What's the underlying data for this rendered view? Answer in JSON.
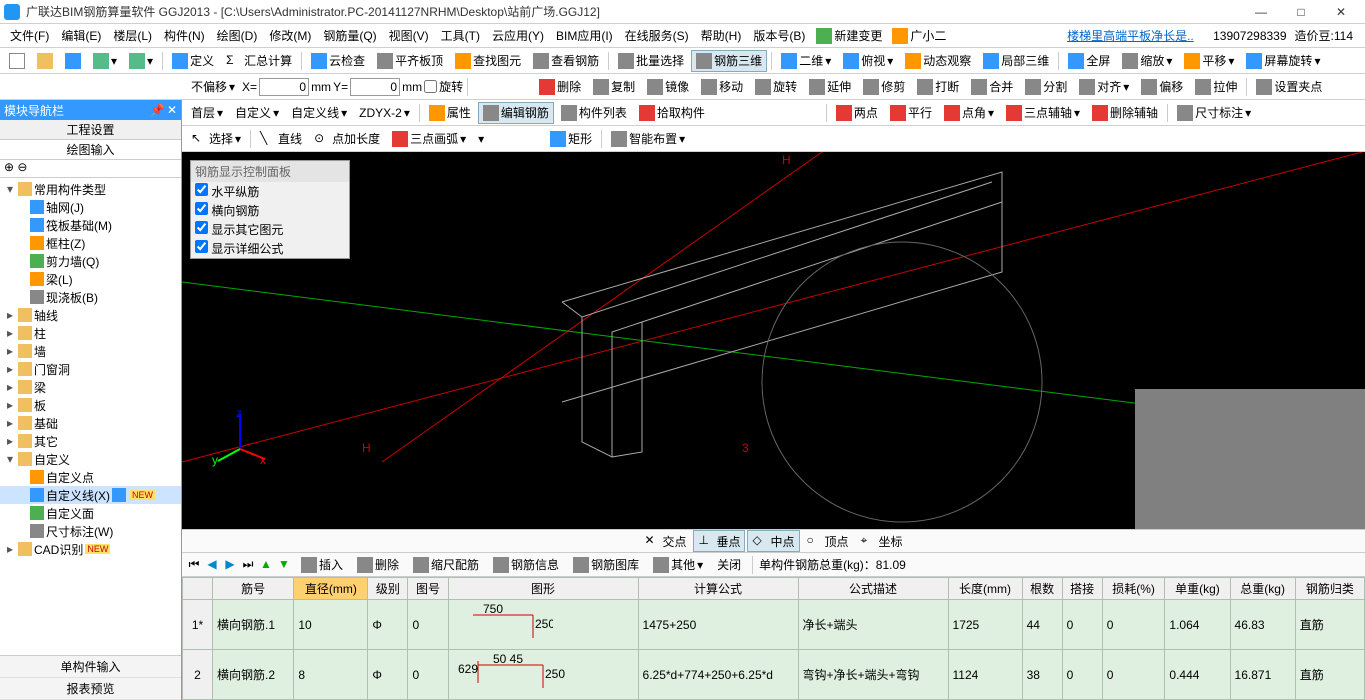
{
  "title": "广联达BIM钢筋算量软件 GGJ2013 - [C:\\Users\\Administrator.PC-20141127NRHM\\Desktop\\站前广场.GGJ12]",
  "menu": [
    "文件(F)",
    "编辑(E)",
    "楼层(L)",
    "构件(N)",
    "绘图(D)",
    "修改(M)",
    "钢筋量(Q)",
    "视图(V)",
    "工具(T)",
    "云应用(Y)",
    "BIM应用(I)",
    "在线服务(S)",
    "帮助(H)",
    "版本号(B)"
  ],
  "menuRight": {
    "newchange": "新建变更",
    "user": "广小二",
    "link": "楼梯里高端平板净长是..",
    "account": "13907298339",
    "credits": "造价豆:114"
  },
  "tb1": {
    "define": "定义",
    "sumcalc": "汇总计算",
    "cloudcheck": "云检查",
    "leveltop": "平齐板顶",
    "findgraph": "查找图元",
    "viewrebar": "查看钢筋",
    "batchsel": "批量选择",
    "rebar3d": "钢筋三维",
    "view2d": "二维",
    "bird": "俯视",
    "dynview": "动态观察",
    "localview": "局部三维",
    "fullscreen": "全屏",
    "zoom": "缩放",
    "pan": "平移",
    "rotscreen": "屏幕旋转"
  },
  "tb2": {
    "nooffset": "不偏移",
    "x": "X=",
    "xv": "0",
    "mm": "mm",
    "y": "Y=",
    "yv": "0",
    "rotate": "旋转",
    "del": "删除",
    "copy": "复制",
    "mirror": "镜像",
    "move": "移动",
    "rot": "旋转",
    "extend": "延伸",
    "trim": "修剪",
    "break": "打断",
    "merge": "合并",
    "split": "分割",
    "align": "对齐",
    "offset": "偏移",
    "stretch": "拉伸",
    "setclip": "设置夹点"
  },
  "tb3": {
    "floor": "首层",
    "custom": "自定义",
    "customline": "自定义线",
    "zdyx": "ZDYX-2",
    "attr": "属性",
    "editrebar": "编辑钢筋",
    "complist": "构件列表",
    "pickcomp": "拾取构件",
    "twopoint": "两点",
    "parallel": "平行",
    "angle": "点角",
    "axisauxmulti": "三点辅轴",
    "delaux": "删除辅轴",
    "dimnote": "尺寸标注"
  },
  "tb4": {
    "select": "选择",
    "line": "直线",
    "addlen": "点加长度",
    "arc3": "三点画弧",
    "rect": "矩形",
    "smartlayout": "智能布置"
  },
  "leftpanel": {
    "title": "模块导航栏",
    "tab1": "工程设置",
    "tab2": "绘图输入"
  },
  "tree": {
    "root": "常用构件类型",
    "items": [
      "轴网(J)",
      "筏板基础(M)",
      "框柱(Z)",
      "剪力墙(Q)",
      "梁(L)",
      "现浇板(B)"
    ],
    "cats": [
      "轴线",
      "柱",
      "墙",
      "门窗洞",
      "梁",
      "板",
      "基础",
      "其它",
      "自定义"
    ],
    "custom": [
      "自定义点",
      "自定义线(X)",
      "自定义面",
      "尺寸标注(W)"
    ],
    "cad": "CAD识别"
  },
  "lpBottom": [
    "单构件输入",
    "报表预览"
  ],
  "panel": {
    "title": "钢筋显示控制面板",
    "opts": [
      "水平纵筋",
      "横向钢筋",
      "显示其它图元",
      "显示详细公式"
    ]
  },
  "snap": {
    "intersect": "交点",
    "vert": "垂点",
    "mid": "中点",
    "peak": "顶点",
    "coord": "坐标"
  },
  "rebarbar": {
    "insert": "插入",
    "delete": "删除",
    "scalerebar": "缩尺配筋",
    "rebarinfo": "钢筋信息",
    "rebarlib": "钢筋图库",
    "other": "其他",
    "close": "关闭",
    "total": "单构件钢筋总重(kg)：81.09"
  },
  "gridHead": [
    "筋号",
    "直径(mm)",
    "级别",
    "图号",
    "图形",
    "计算公式",
    "公式描述",
    "长度(mm)",
    "根数",
    "搭接",
    "损耗(%)",
    "单重(kg)",
    "总重(kg)",
    "钢筋归类"
  ],
  "rows": [
    {
      "n": "1*",
      "id": "横向钢筋.1",
      "dia": "10",
      "lvl": "Φ",
      "pic": "0",
      "shape": "750 250",
      "formula": "1475+250",
      "desc": "净长+端头",
      "len": "1725",
      "qty": "44",
      "lap": "0",
      "loss": "0",
      "uw": "1.064",
      "tw": "46.83",
      "cat": "直筋"
    },
    {
      "n": "2",
      "id": "横向钢筋.2",
      "dia": "8",
      "lvl": "Φ",
      "pic": "0",
      "shape": "50 45 629 250",
      "formula": "6.25*d+774+250+6.25*d",
      "desc": "弯钩+净长+端头+弯钩",
      "len": "1124",
      "qty": "38",
      "lap": "0",
      "loss": "0",
      "uw": "0.444",
      "tw": "16.871",
      "cat": "直筋"
    }
  ]
}
